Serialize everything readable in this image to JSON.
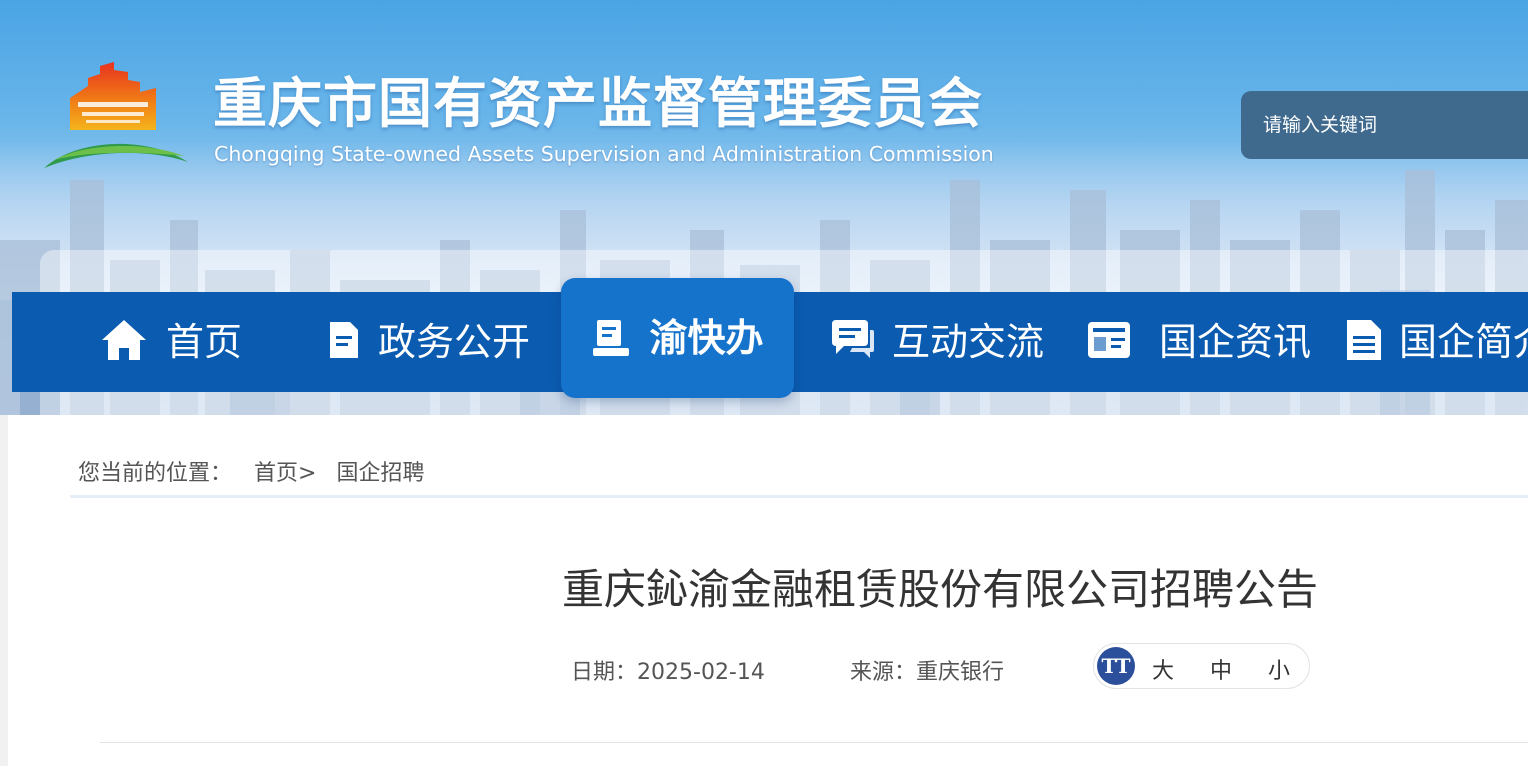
{
  "header": {
    "title": "重庆市国有资产监督管理委员会",
    "subtitle": "Chongqing State-owned Assets Supervision and Administration Commission",
    "search_placeholder": "请输入关键词"
  },
  "nav": {
    "items": [
      {
        "label": "首页",
        "icon": "home-icon"
      },
      {
        "label": "政务公开",
        "icon": "document-icon"
      },
      {
        "label": "渝快办",
        "icon": "desk-icon",
        "active": true
      },
      {
        "label": "互动交流",
        "icon": "chat-icon"
      },
      {
        "label": "国企资讯",
        "icon": "news-card-icon"
      },
      {
        "label": "国企简介",
        "icon": "file-list-icon"
      }
    ]
  },
  "breadcrumb": {
    "prefix": "您当前的位置：",
    "home": "首页",
    "separator": ">",
    "current": "国企招聘"
  },
  "article": {
    "title": "重庆鈊渝金融租赁股份有限公司招聘公告",
    "date_label": "日期：",
    "date": "2025-02-14",
    "source_label": "来源：",
    "source": "重庆银行"
  },
  "font_size": {
    "icon": "text-size-icon",
    "icon_text": "TT",
    "large": "大",
    "medium": "中",
    "small": "小"
  },
  "colors": {
    "nav_bg": "#0b5bb0",
    "nav_active": "#1673cc",
    "search_bg": "#3f6a8e",
    "font_icon_bg": "#2c4f9c"
  }
}
